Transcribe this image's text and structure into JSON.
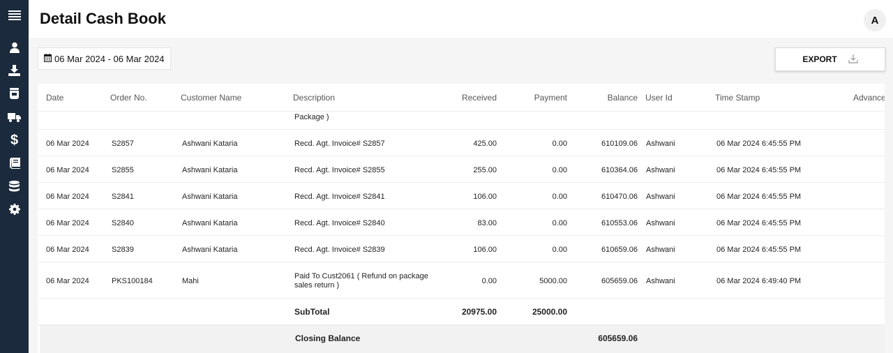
{
  "header": {
    "title": "Detail Cash Book",
    "avatar_initial": "A"
  },
  "sidebar": {
    "items": [
      {
        "icon": "menu-icon"
      },
      {
        "icon": "user-icon"
      },
      {
        "icon": "download-icon"
      },
      {
        "icon": "jar-icon"
      },
      {
        "icon": "truck-icon"
      },
      {
        "icon": "dollar-icon"
      },
      {
        "icon": "book-icon"
      },
      {
        "icon": "database-icon"
      },
      {
        "icon": "gear-icon"
      }
    ]
  },
  "toolbar": {
    "date_range": "06 Mar 2024 - 06 Mar 2024",
    "export_label": "EXPORT"
  },
  "table": {
    "columns": {
      "date": "Date",
      "order": "Order No.",
      "customer": "Customer Name",
      "description": "Description",
      "received": "Received",
      "payment": "Payment",
      "balance": "Balance",
      "user": "User Id",
      "timestamp": "Time Stamp",
      "advance": "Advance"
    },
    "partial_row_text": "Package )",
    "rows": [
      {
        "date": "06 Mar 2024",
        "order": "S2857",
        "customer": "Ashwani Kataria",
        "description": "Recd. Agt. Invoice# S2857",
        "received": "425.00",
        "payment": "0.00",
        "balance": "610109.06",
        "user": "Ashwani",
        "timestamp": "06 Mar 2024 6:45:55 PM"
      },
      {
        "date": "06 Mar 2024",
        "order": "S2855",
        "customer": "Ashwani Kataria",
        "description": "Recd. Agt. Invoice# S2855",
        "received": "255.00",
        "payment": "0.00",
        "balance": "610364.06",
        "user": "Ashwani",
        "timestamp": "06 Mar 2024 6:45:55 PM"
      },
      {
        "date": "06 Mar 2024",
        "order": "S2841",
        "customer": "Ashwani Kataria",
        "description": "Recd. Agt. Invoice# S2841",
        "received": "106.00",
        "payment": "0.00",
        "balance": "610470.06",
        "user": "Ashwani",
        "timestamp": "06 Mar 2024 6:45:55 PM"
      },
      {
        "date": "06 Mar 2024",
        "order": "S2840",
        "customer": "Ashwani Kataria",
        "description": "Recd. Agt. Invoice# S2840",
        "received": "83.00",
        "payment": "0.00",
        "balance": "610553.06",
        "user": "Ashwani",
        "timestamp": "06 Mar 2024 6:45:55 PM"
      },
      {
        "date": "06 Mar 2024",
        "order": "S2839",
        "customer": "Ashwani Kataria",
        "description": "Recd. Agt. Invoice# S2839",
        "received": "106.00",
        "payment": "0.00",
        "balance": "610659.06",
        "user": "Ashwani",
        "timestamp": "06 Mar 2024 6:45:55 PM"
      },
      {
        "date": "06 Mar 2024",
        "order": "PKS100184",
        "customer": "Mahi",
        "description_line1": "Paid To Cust2061 ( Refund on package",
        "description_line2": "sales return )",
        "received": "0.00",
        "payment": "5000.00",
        "balance": "605659.06",
        "user": "Ashwani",
        "timestamp": "06 Mar 2024 6:49:40 PM"
      }
    ],
    "subtotal": {
      "label": "SubTotal",
      "received": "20975.00",
      "payment": "25000.00"
    },
    "closing": {
      "label": "Closing Balance",
      "balance": "605659.06"
    }
  }
}
